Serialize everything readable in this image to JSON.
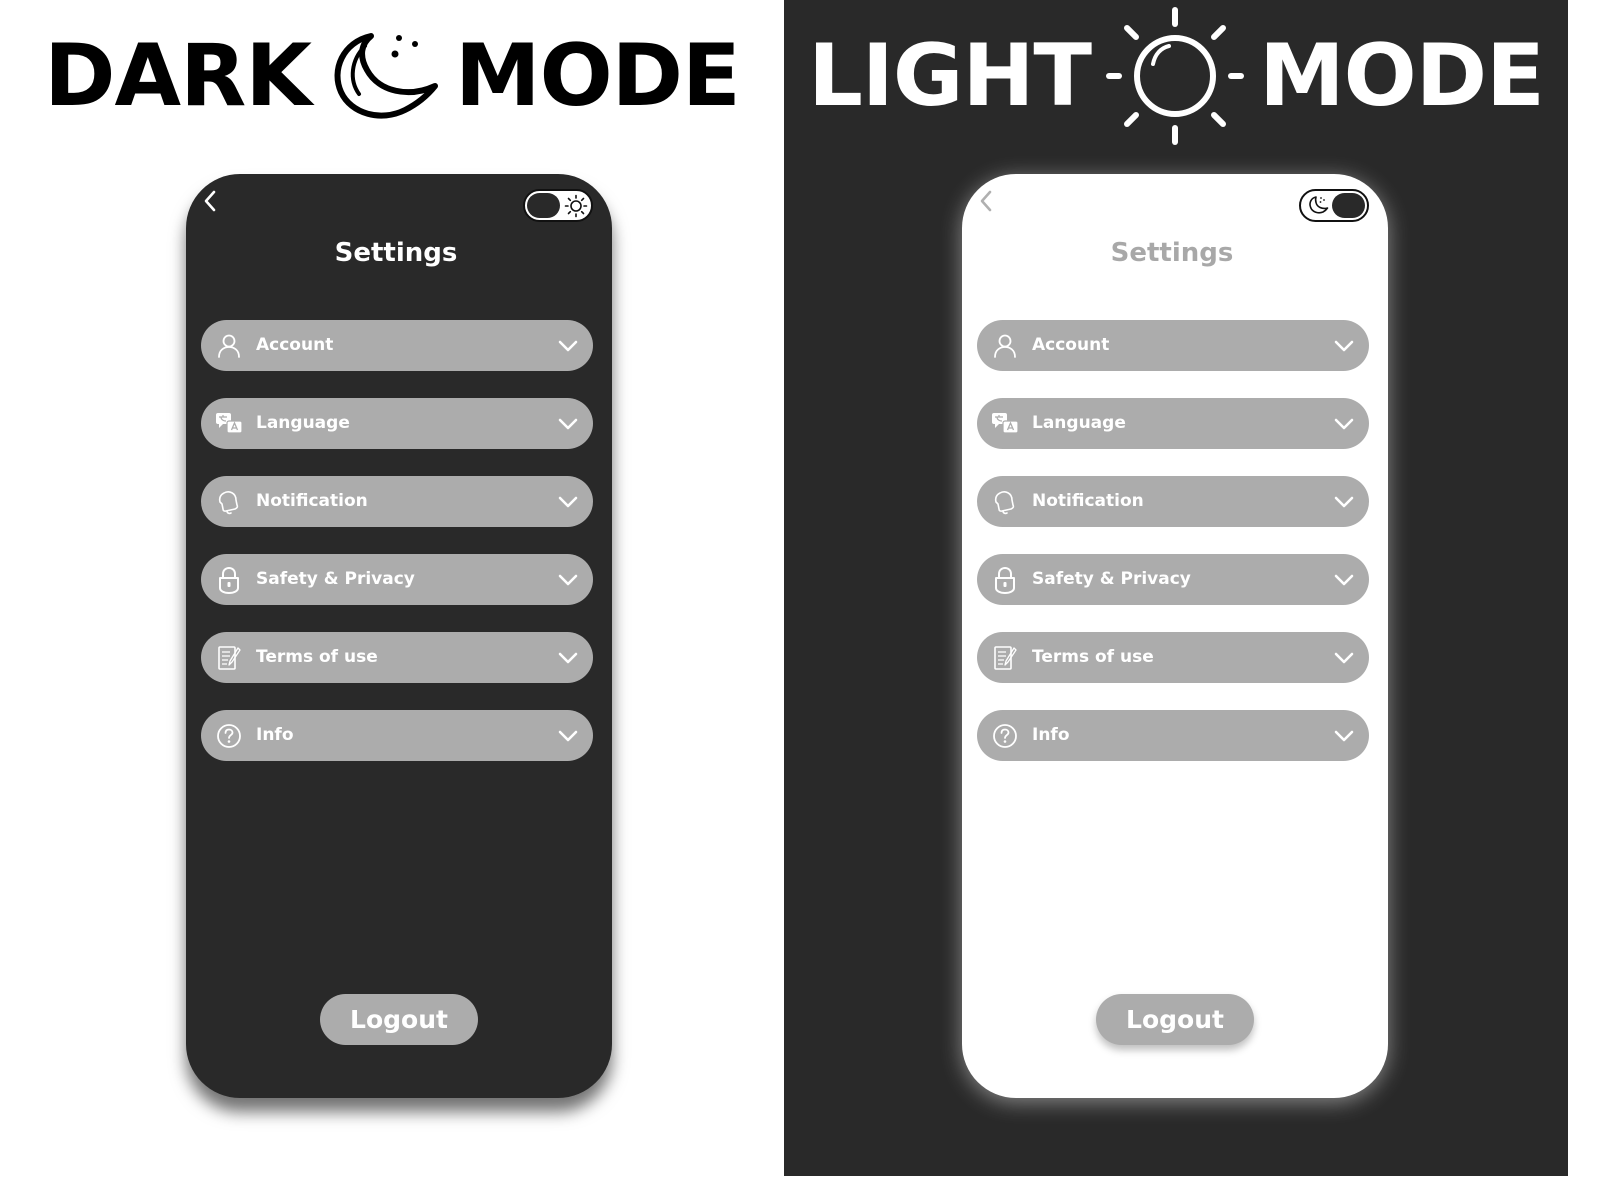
{
  "dark_panel": {
    "heading_left": "DARK",
    "heading_right": "MODE",
    "heading_icon": "moon-icon",
    "phone": {
      "back_icon": "chevron-left-icon",
      "toggle_icon": "sun-icon",
      "title": "Settings",
      "logout_label": "Logout"
    }
  },
  "light_panel": {
    "heading_left": "LIGHT",
    "heading_right": "MODE",
    "heading_icon": "sun-icon",
    "phone": {
      "back_icon": "chevron-left-icon",
      "toggle_icon": "moon-icon",
      "title": "Settings",
      "logout_label": "Logout"
    }
  },
  "menu_items": [
    {
      "label": "Account",
      "icon": "user-icon"
    },
    {
      "label": "Language",
      "icon": "translate-icon"
    },
    {
      "label": "Notification",
      "icon": "bell-icon"
    },
    {
      "label": "Safety & Privacy",
      "icon": "lock-icon"
    },
    {
      "label": "Terms of use",
      "icon": "document-icon"
    },
    {
      "label": "Info",
      "icon": "question-icon"
    }
  ],
  "colors": {
    "dark_bg": "#292929",
    "light_bg": "#ffffff",
    "menu_pill": "#acacac",
    "light_title": "#a8a8a8"
  }
}
